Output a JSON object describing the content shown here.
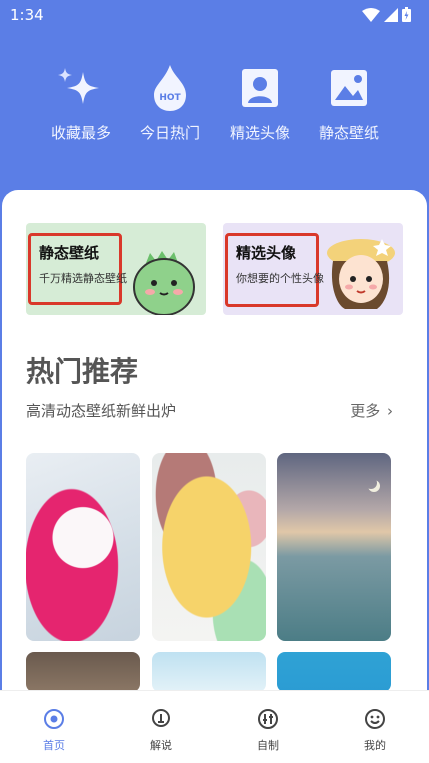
{
  "status": {
    "time": "1:34"
  },
  "top_nav": [
    {
      "label": "收藏最多",
      "icon": "sparkle-icon"
    },
    {
      "label": "今日热门",
      "icon": "hot-flame-icon",
      "badge": "HOT"
    },
    {
      "label": "精选头像",
      "icon": "portrait-icon"
    },
    {
      "label": "静态壁纸",
      "icon": "image-icon"
    }
  ],
  "banners": {
    "left": {
      "title": "静态壁纸",
      "desc": "千万精选静态壁纸"
    },
    "right": {
      "title": "精选头像",
      "desc": "你想要的个性头像"
    }
  },
  "section": {
    "title": "热门推荐",
    "subtitle": "高清动态壁纸新鲜出炉",
    "more": "更多"
  },
  "bottom_nav": [
    {
      "label": "首页",
      "icon": "home-target-icon"
    },
    {
      "label": "解说",
      "icon": "pin-icon"
    },
    {
      "label": "自制",
      "icon": "equalizer-icon"
    },
    {
      "label": "我的",
      "icon": "smile-icon"
    }
  ],
  "colors": {
    "accent": "#5b7ee6",
    "highlight_box": "#d9382a"
  }
}
